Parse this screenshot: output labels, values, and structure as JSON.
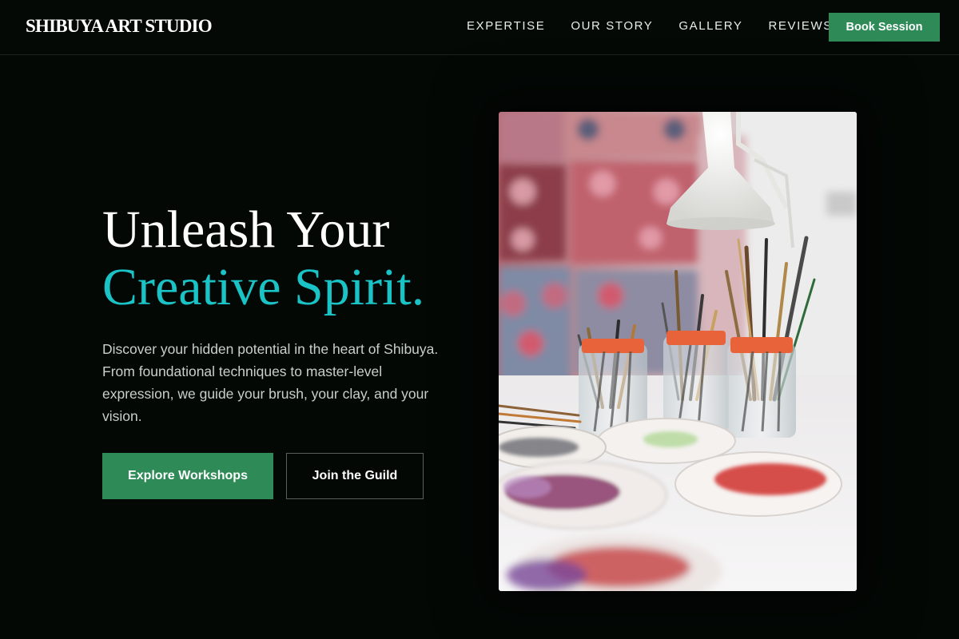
{
  "brand": {
    "name": "SHIBUYA ART STUDIO"
  },
  "nav": {
    "links": [
      "EXPERTISE",
      "OUR STORY",
      "GALLERY",
      "REVIEWS"
    ],
    "cta_label": "Book Session"
  },
  "hero": {
    "title_line1": "Unleash Your",
    "title_line2": "Creative Spirit.",
    "description": "Discover your hidden potential in the heart of Shibuya. From foundational techniques to master-level expression, we guide your brush, your clay, and your vision.",
    "primary_button": "Explore Workshops",
    "secondary_button": "Join the Guild",
    "image": {
      "icon": "studio-photo"
    }
  },
  "colors": {
    "background": "#030805",
    "accent_green": "#2e8b57",
    "accent_teal": "#19c3c6",
    "body_text": "#c9cfcc"
  }
}
